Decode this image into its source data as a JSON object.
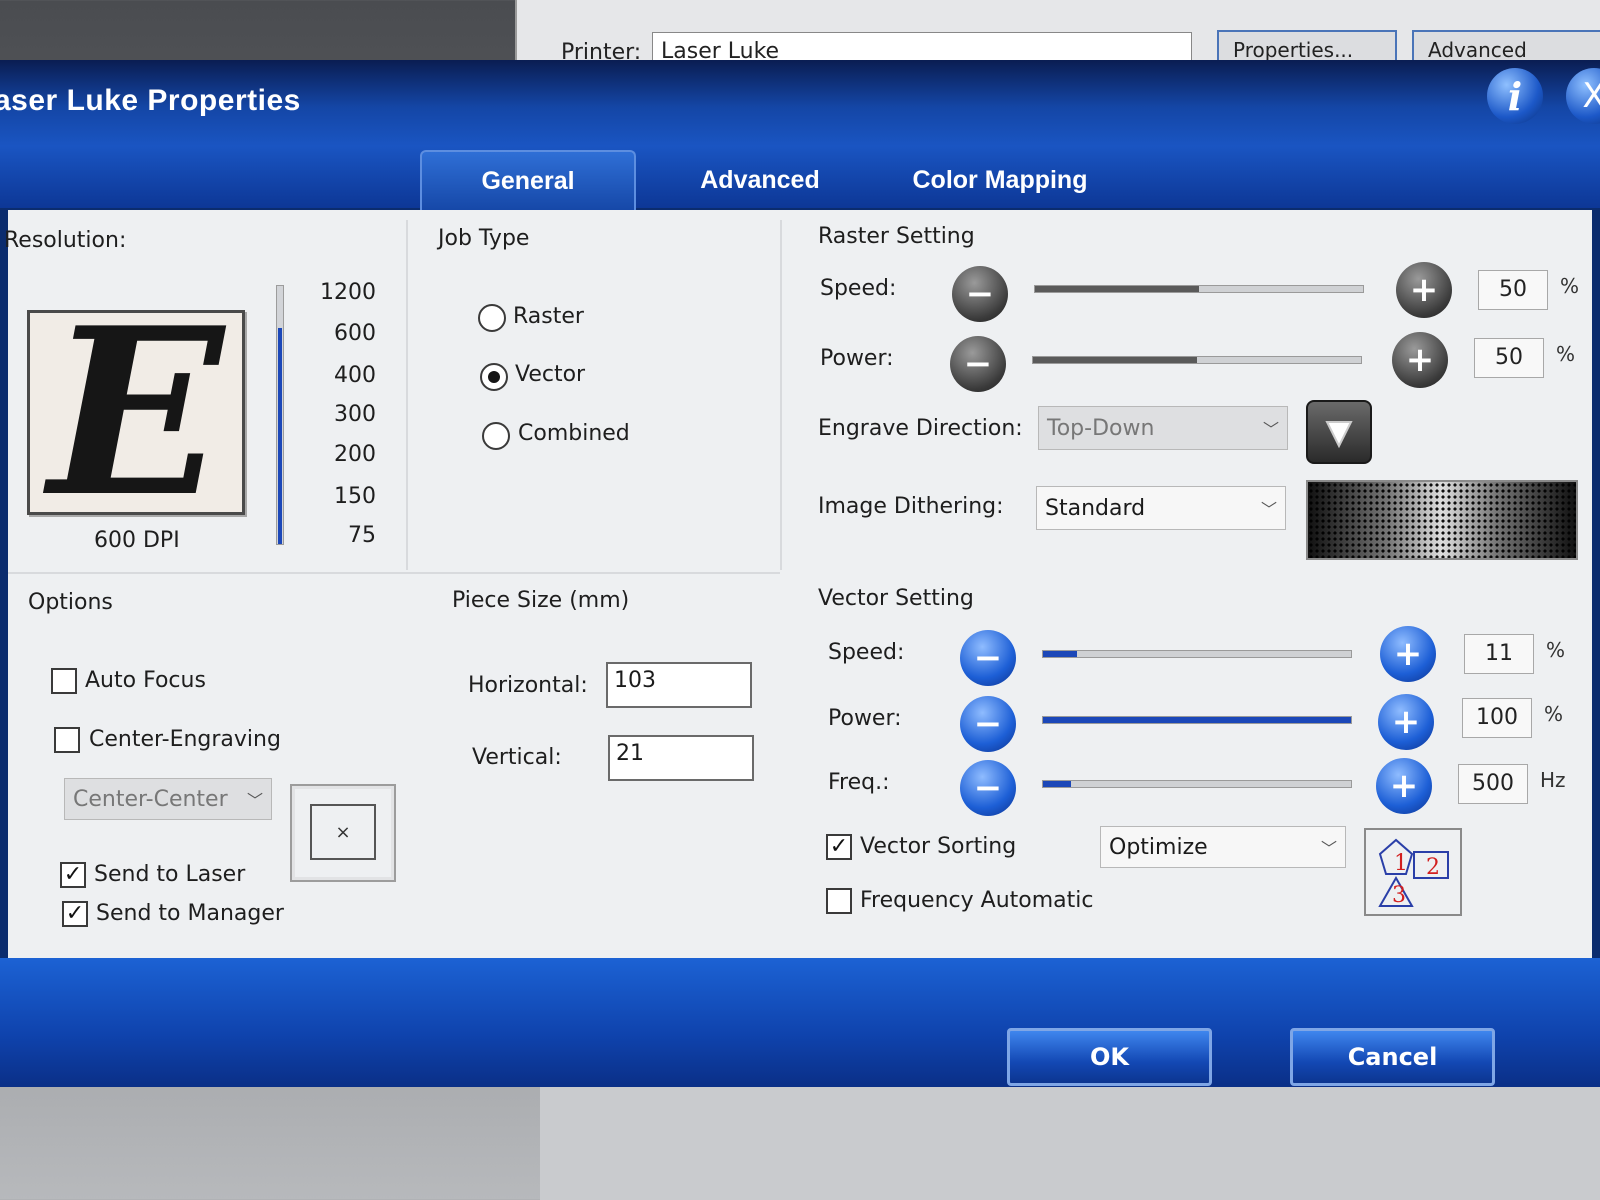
{
  "background": {
    "printer_label": "Printer:",
    "printer_value": "Laser Luke",
    "properties_button": "Properties...",
    "advanced_button": "Advanced"
  },
  "window": {
    "title": "aser Luke Properties",
    "info_glyph": "i",
    "close_glyph": "X"
  },
  "tabs": [
    {
      "label": "General",
      "active": true
    },
    {
      "label": "Advanced",
      "active": false
    },
    {
      "label": "Color Mapping",
      "active": false
    }
  ],
  "resolution": {
    "heading": "Resolution:",
    "preview_letter": "E",
    "current_label": "600 DPI",
    "ticks": [
      "1200",
      "600",
      "400",
      "300",
      "200",
      "150",
      "75"
    ],
    "selected": "600"
  },
  "job_type": {
    "heading": "Job Type",
    "options": [
      {
        "label": "Raster",
        "selected": false
      },
      {
        "label": "Vector",
        "selected": true
      },
      {
        "label": "Combined",
        "selected": false
      }
    ]
  },
  "options": {
    "heading": "Options",
    "auto_focus": {
      "label": "Auto Focus",
      "checked": false
    },
    "center_engraving": {
      "label": "Center-Engraving",
      "checked": false
    },
    "center_select": "Center-Center",
    "position_glyph": "×",
    "send_to_laser": {
      "label": "Send to Laser",
      "checked": true
    },
    "send_to_manager": {
      "label": "Send to Manager",
      "checked": true
    }
  },
  "piece_size": {
    "heading": "Piece Size (mm)",
    "horizontal_label": "Horizontal:",
    "horizontal_value": "103",
    "vertical_label": "Vertical:",
    "vertical_value": "21"
  },
  "raster_setting": {
    "heading": "Raster Setting",
    "speed": {
      "label": "Speed:",
      "value": "50",
      "unit": "%"
    },
    "power": {
      "label": "Power:",
      "value": "50",
      "unit": "%"
    },
    "engrave_direction_label": "Engrave Direction:",
    "engrave_direction_value": "Top-Down",
    "image_dithering_label": "Image Dithering:",
    "image_dithering_value": "Standard"
  },
  "vector_setting": {
    "heading": "Vector Setting",
    "speed": {
      "label": "Speed:",
      "value": "11",
      "unit": "%"
    },
    "power": {
      "label": "Power:",
      "value": "100",
      "unit": "%"
    },
    "freq": {
      "label": "Freq.:",
      "value": "500",
      "unit": "Hz",
      "level": 0.09
    },
    "vector_sorting": {
      "label": "Vector Sorting",
      "checked": true
    },
    "sorting_value": "Optimize",
    "frequency_automatic": {
      "label": "Frequency Automatic",
      "checked": false
    },
    "sort_icon_numbers": [
      "1",
      "2",
      "3"
    ]
  },
  "buttons": {
    "minus": "−",
    "plus": "+",
    "ok": "OK",
    "cancel": "Cancel"
  },
  "colors": {
    "title_blue": "#1446a6",
    "slider_blue": "#1b47b8",
    "panel_bg": "#eef0f2"
  }
}
